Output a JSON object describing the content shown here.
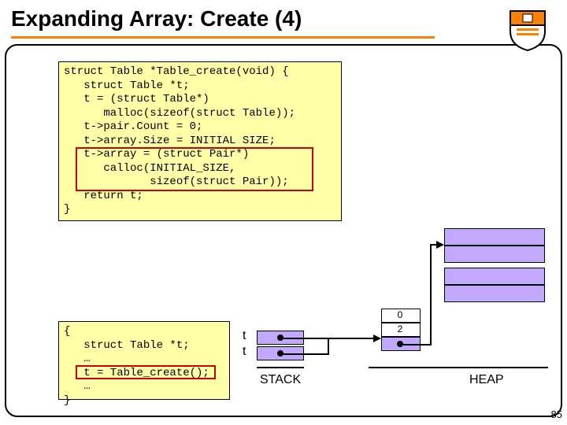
{
  "title": "Expanding Array: Create (4)",
  "code1": {
    "l0": "struct Table *Table_create(void) {",
    "l1": "   struct Table *t;",
    "l2": "   t = (struct Table*)",
    "l3": "      malloc(sizeof(struct Table));",
    "l4": "   t->pair.Count = 0;",
    "l5": "   t->array.Size = INITIAL SIZE;",
    "l6": "   t->array = (struct Pair*)",
    "l7": "      calloc(INITIAL_SIZE,",
    "l8": "             sizeof(struct Pair));",
    "l9": "   return t;",
    "l10": "}"
  },
  "code2": {
    "l0": "{",
    "l1": "   struct Table *t;",
    "l2": "   …",
    "l3": "   t = Table_create();",
    "l4": "   …",
    "l5": "}"
  },
  "stack": {
    "t1": "t",
    "t2": "t",
    "label": "STACK"
  },
  "heap": {
    "label": "HEAP",
    "n0": "0",
    "n2": "2"
  },
  "page": "85"
}
